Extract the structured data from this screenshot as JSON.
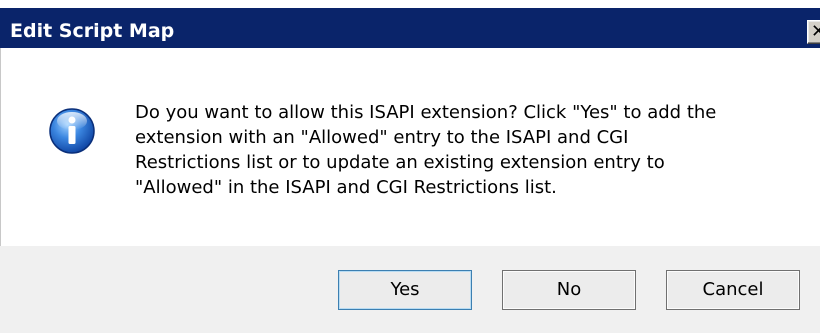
{
  "window": {
    "title": "Edit Script Map",
    "close_glyph": "✕",
    "close_icon": "close-icon"
  },
  "message": {
    "icon": "info-icon",
    "text": "Do you want to allow this ISAPI extension? Click \"Yes\" to add the\nextension with an \"Allowed\" entry to the ISAPI and CGI\nRestrictions list or to update an existing extension entry to\n\"Allowed\" in the ISAPI and CGI Restrictions list."
  },
  "buttons": {
    "yes_label": "Yes",
    "no_label": "No",
    "cancel_label": "Cancel"
  },
  "colors": {
    "titlebar": "#0a246a",
    "button_bar": "#f0f0f0",
    "icon_blue": "#2a6fd0"
  }
}
